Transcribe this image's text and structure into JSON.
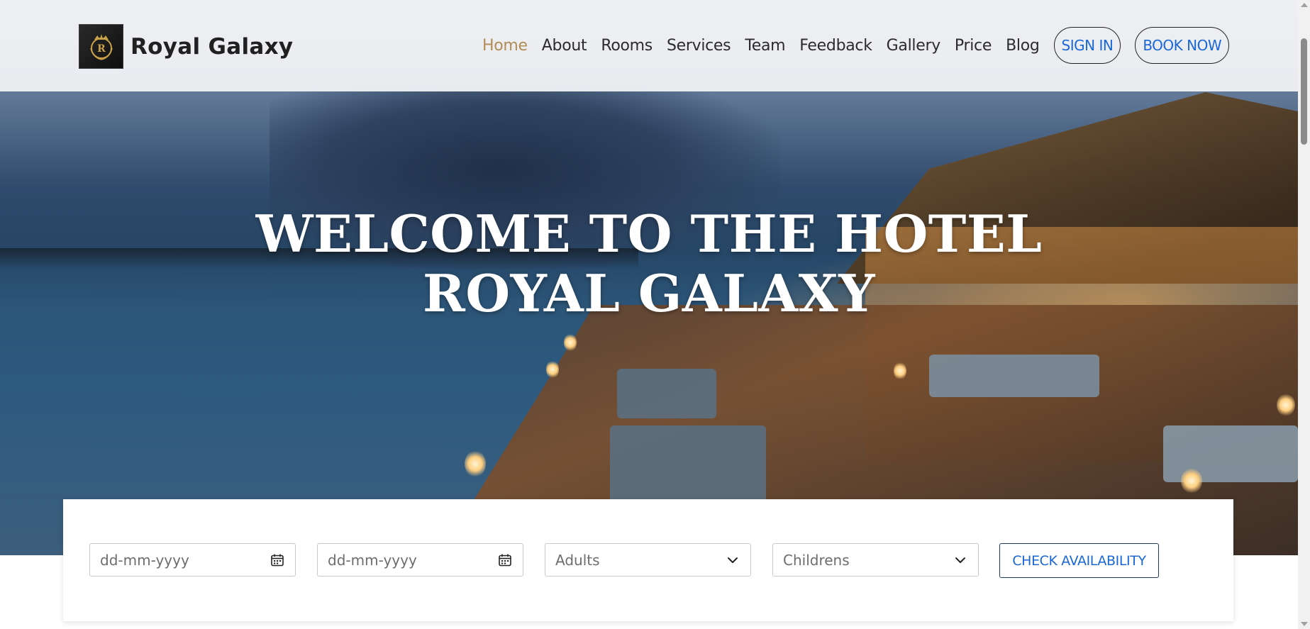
{
  "brand": {
    "name": "Royal Galaxy",
    "logo_letter": "R",
    "logo_colors": {
      "background": "#111111",
      "gold": "#c9a24a"
    }
  },
  "nav": {
    "items": [
      {
        "label": "Home",
        "active": true
      },
      {
        "label": "About",
        "active": false
      },
      {
        "label": "Rooms",
        "active": false
      },
      {
        "label": "Services",
        "active": false
      },
      {
        "label": "Team",
        "active": false
      },
      {
        "label": "Feedback",
        "active": false
      },
      {
        "label": "Gallery",
        "active": false
      },
      {
        "label": "Price",
        "active": false
      },
      {
        "label": "Blog",
        "active": false
      }
    ],
    "signin_label": "SIGN IN",
    "book_label": "BOOK NOW",
    "active_color": "#b08d57",
    "pill_text_color": "#1a67d8"
  },
  "hero": {
    "title": "WELCOME TO THE HOTEL ROYAL GALAXY"
  },
  "booking": {
    "checkin_placeholder": "dd-mm-yyyy",
    "checkout_placeholder": "dd-mm-yyyy",
    "adults_label": "Adults",
    "children_label": "Childrens",
    "check_button": "CHECK AVAILABILITY",
    "icons": {
      "date": "calendar-icon",
      "select": "chevron-down-icon"
    }
  }
}
